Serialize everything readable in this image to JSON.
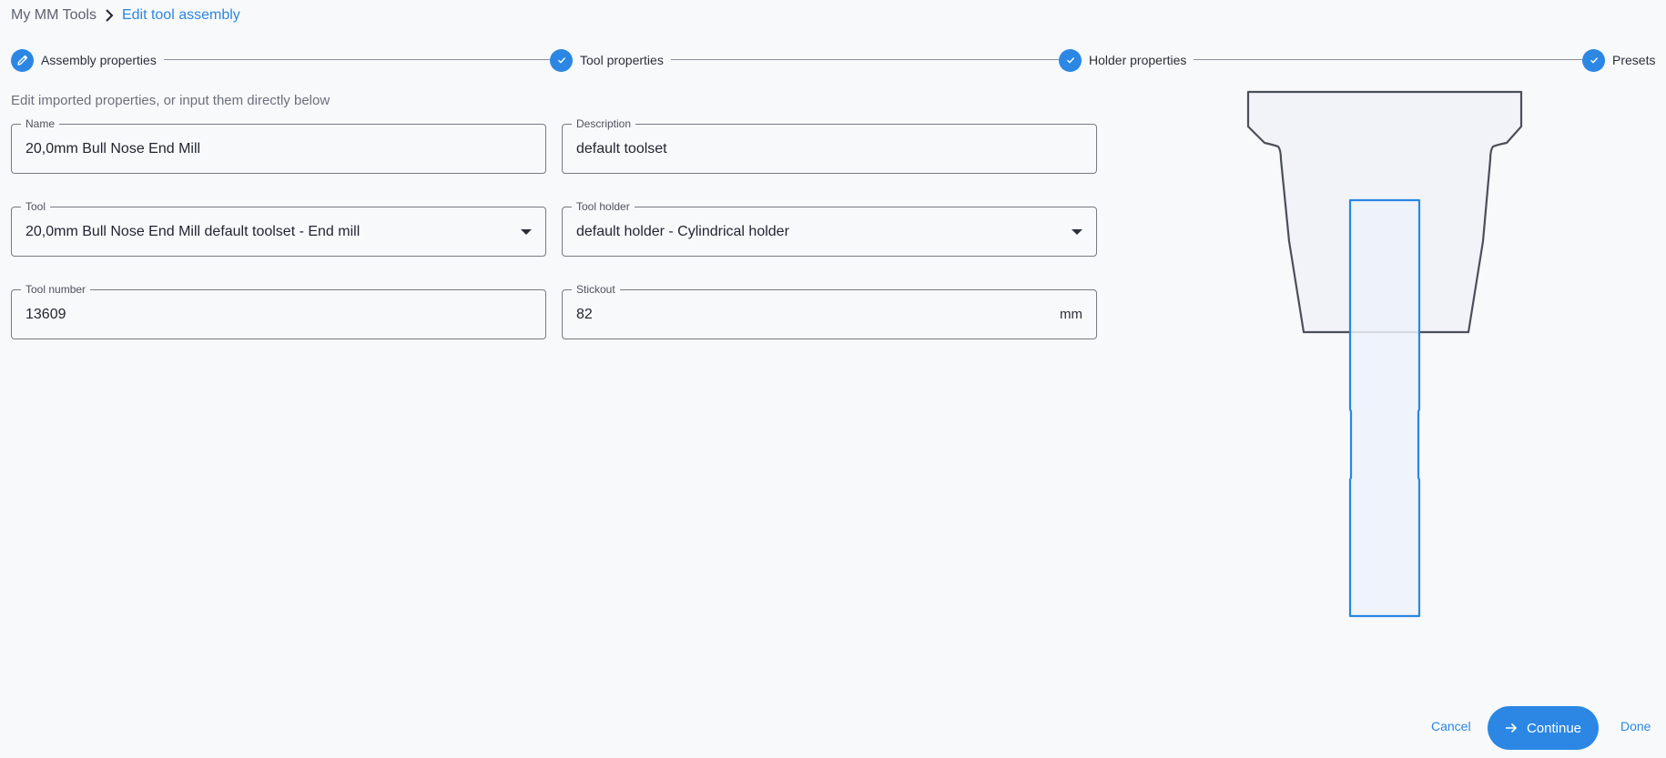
{
  "breadcrumb": {
    "root": "My MM Tools",
    "current": "Edit tool assembly"
  },
  "stepper": {
    "steps": [
      {
        "label": "Assembly properties",
        "icon": "pencil-icon",
        "state": "active"
      },
      {
        "label": "Tool properties",
        "icon": "check-icon",
        "state": "complete"
      },
      {
        "label": "Holder properties",
        "icon": "check-icon",
        "state": "complete"
      },
      {
        "label": "Presets",
        "icon": "check-icon",
        "state": "complete"
      }
    ]
  },
  "intro": "Edit imported properties, or input them directly below",
  "form": {
    "name": {
      "label": "Name",
      "value": "20,0mm Bull Nose End Mill"
    },
    "description": {
      "label": "Description",
      "value": "default toolset"
    },
    "tool": {
      "label": "Tool",
      "value": "20,0mm Bull Nose End Mill default toolset - End mill"
    },
    "tool_holder": {
      "label": "Tool holder",
      "value": "default holder - Cylindrical holder"
    },
    "tool_number": {
      "label": "Tool number",
      "value": "13609"
    },
    "stickout": {
      "label": "Stickout",
      "value": "82",
      "unit": "mm"
    }
  },
  "footer": {
    "cancel": "Cancel",
    "continue": "Continue",
    "done": "Done"
  },
  "colors": {
    "accent": "#2b87e3",
    "holder_outline": "#4a4f59",
    "tool_outline": "#2b87e3",
    "background": "#f8f9fb"
  }
}
